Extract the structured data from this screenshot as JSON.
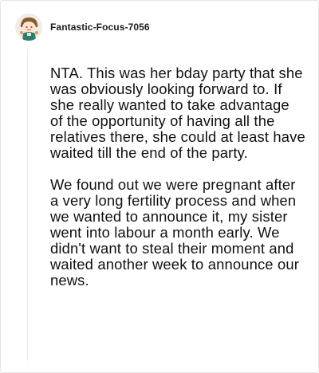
{
  "comment": {
    "username": "Fantastic-Focus-7056",
    "avatar_icon": "reddit-snoo-avatar-icon",
    "paragraphs": [
      "NTA. This was her bday party that she was obviously looking forward to. If she really wanted to take advantage of the opportunity of having all the relatives there, she could at least have waited till the end of the party.",
      "We found out we were pregnant after a very long fertility process and when we wanted to announce it, my sister went into labour a month early. We didn't want to steal their moment and waited another week to announce our news."
    ]
  }
}
